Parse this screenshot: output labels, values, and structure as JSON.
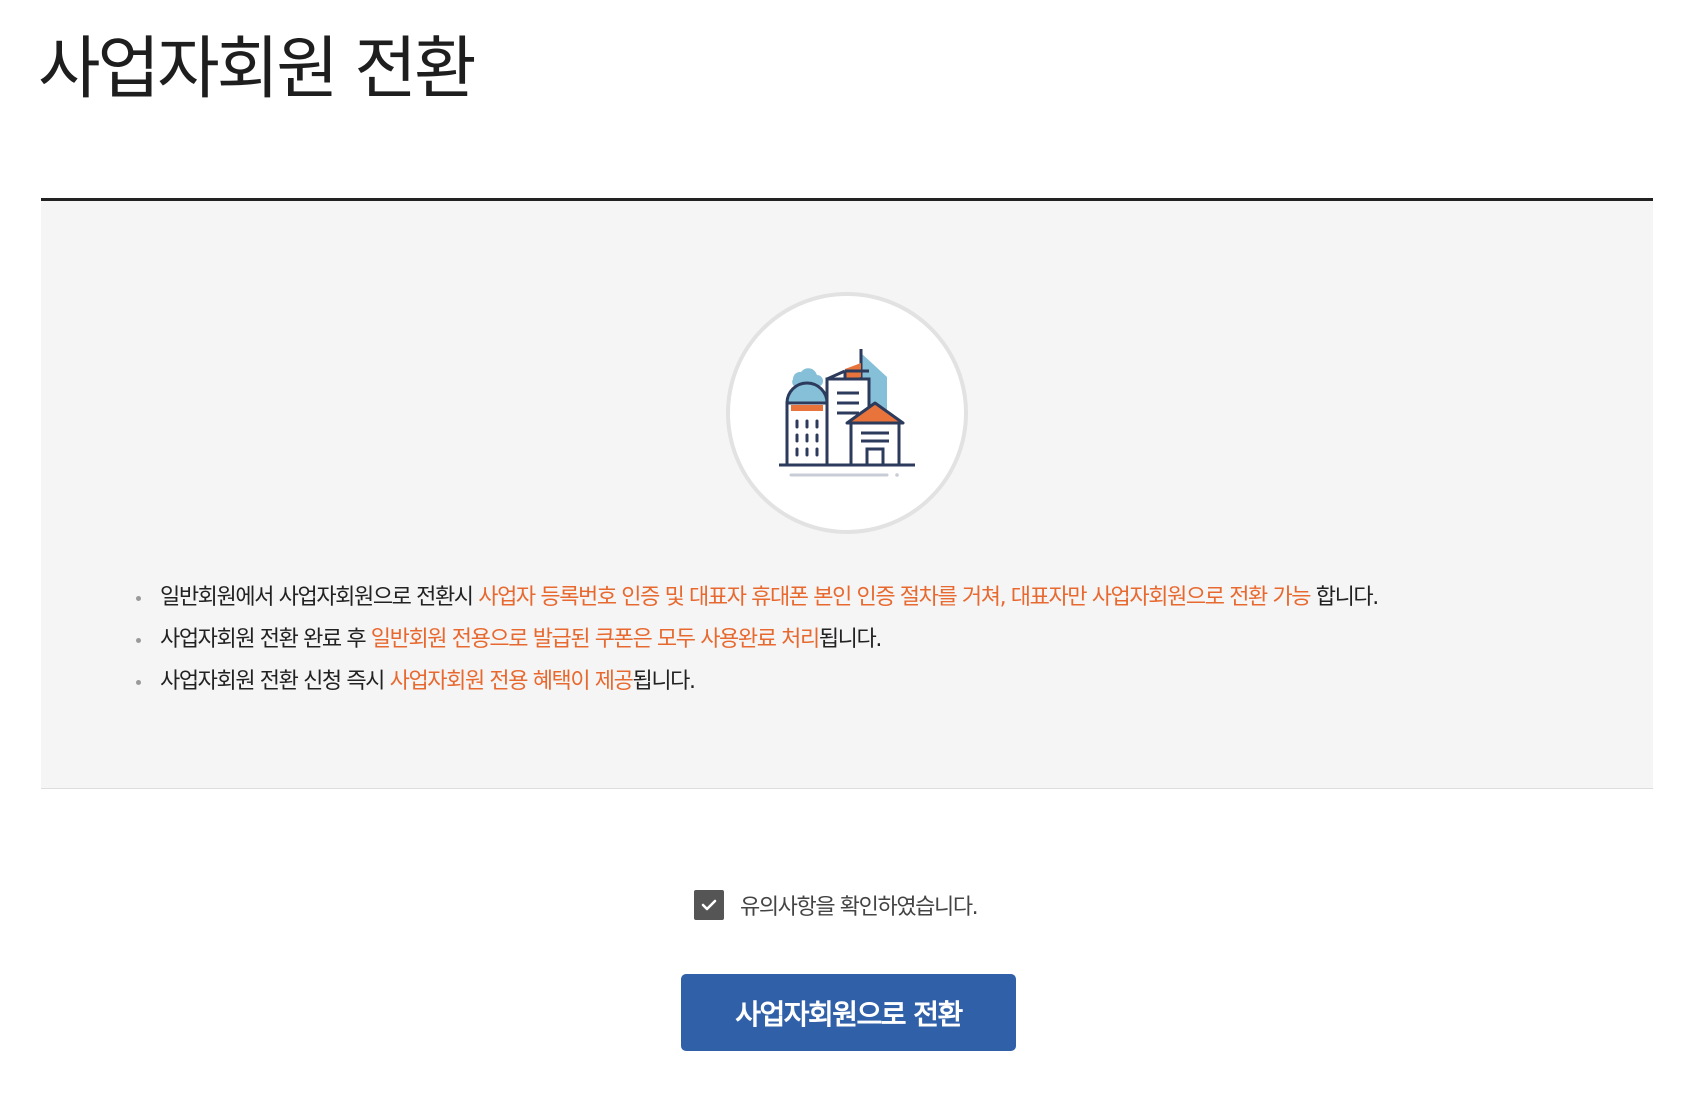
{
  "page": {
    "title": "사업자회원 전환"
  },
  "illustration": {
    "icon": "office-buildings-icon",
    "colors": {
      "outline": "#2c3a5c",
      "orange": "#e8743b",
      "blue": "#86bfd8"
    }
  },
  "notices": [
    {
      "before": "일반회원에서 사업자회원으로 전환시 ",
      "highlight": "사업자 등록번호 인증 및 대표자 휴대폰 본인 인증 절차를 거쳐, 대표자만 사업자회원으로 전환 가능",
      "after": " 합니다."
    },
    {
      "before": "사업자회원 전환 완료 후 ",
      "highlight": "일반회원 전용으로 발급된 쿠폰은 모두 사용완료 처리",
      "after": "됩니다."
    },
    {
      "before": "사업자회원 전환 신청 즉시 ",
      "highlight": "사업자회원 전용 혜택이 제공",
      "after": "됩니다."
    }
  ],
  "agreement": {
    "checked": true,
    "label": "유의사항을 확인하였습니다."
  },
  "actions": {
    "convert_label": "사업자회원으로 전환"
  },
  "colors": {
    "highlight": "#e8692f",
    "primary_button": "#3060a8",
    "checkbox": "#555555"
  }
}
